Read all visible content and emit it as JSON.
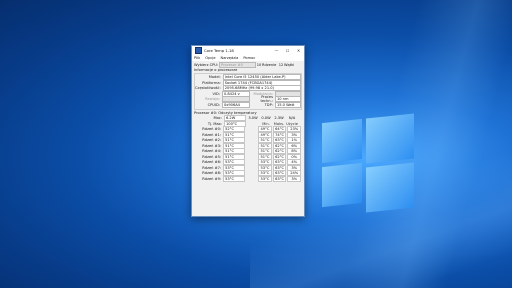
{
  "window": {
    "title": "Core Temp 1.18",
    "minimize": "—",
    "maximize": "☐",
    "close": "✕"
  },
  "menu": [
    "Plik",
    "Opcje",
    "Narzędzia",
    "Pomoc"
  ],
  "cpu_select": {
    "label": "Wybierz CPU:",
    "value": "Procesor #0",
    "cores_value": "10",
    "cores_label": "Rdzenie",
    "threads_value": "12",
    "threads_label": "Wątki"
  },
  "info": {
    "title": "Informacje o procesorze",
    "model_label": "Model:",
    "model": "Intel Core i5 12450 (Alder Lake-P)",
    "platform_label": "Platforma:",
    "platform": "Socket 1744 (FCBGA1744)",
    "freq_label": "Częstotliwość:",
    "freq": "2095.68MHz (99.98 x 21.0)",
    "vid_label": "VID:",
    "vid": "0.8424 v",
    "modulation": "Modulacja:",
    "revision": "Rewizja:",
    "litho_label": "Proces techn.:",
    "litho": "10 nm",
    "cpuid_label": "CPUID:",
    "cpuid": "0x906A4",
    "tdp_label": "TDP:",
    "tdp": "15.0 Watt"
  },
  "temps": {
    "title": "Procesor #0: Odczyty temperatury",
    "power_label": "Moc:",
    "power": [
      "6.2W",
      "3.0W",
      "0.0W",
      "2.3W",
      "N/A"
    ],
    "tjmax_label": "Tj. Max:",
    "tjmax": "100°C",
    "col_min": "Min.",
    "col_max": "Maks.",
    "col_load": "Użycie",
    "cores": [
      {
        "name": "Rdzeń #0:",
        "temp": "52°C",
        "min": "49°C",
        "max": "64°C",
        "load": "23%"
      },
      {
        "name": "Rdzeń #1:",
        "temp": "51°C",
        "min": "49°C",
        "max": "74°C",
        "load": "3%"
      },
      {
        "name": "Rdzeń #2:",
        "temp": "51°C",
        "min": "51°C",
        "max": "63°C",
        "load": "1%"
      },
      {
        "name": "Rdzeń #3:",
        "temp": "51°C",
        "min": "51°C",
        "max": "62°C",
        "load": "6%"
      },
      {
        "name": "Rdzeń #4:",
        "temp": "51°C",
        "min": "51°C",
        "max": "62°C",
        "load": "8%"
      },
      {
        "name": "Rdzeń #5:",
        "temp": "51°C",
        "min": "51°C",
        "max": "62°C",
        "load": "0%"
      },
      {
        "name": "Rdzeń #6:",
        "temp": "53°C",
        "min": "53°C",
        "max": "63°C",
        "load": "4%"
      },
      {
        "name": "Rdzeń #7:",
        "temp": "53°C",
        "min": "53°C",
        "max": "63°C",
        "load": "3%"
      },
      {
        "name": "Rdzeń #8:",
        "temp": "53°C",
        "min": "53°C",
        "max": "63°C",
        "load": "24%"
      },
      {
        "name": "Rdzeń #9:",
        "temp": "53°C",
        "min": "53°C",
        "max": "63°C",
        "load": "3%"
      }
    ]
  }
}
